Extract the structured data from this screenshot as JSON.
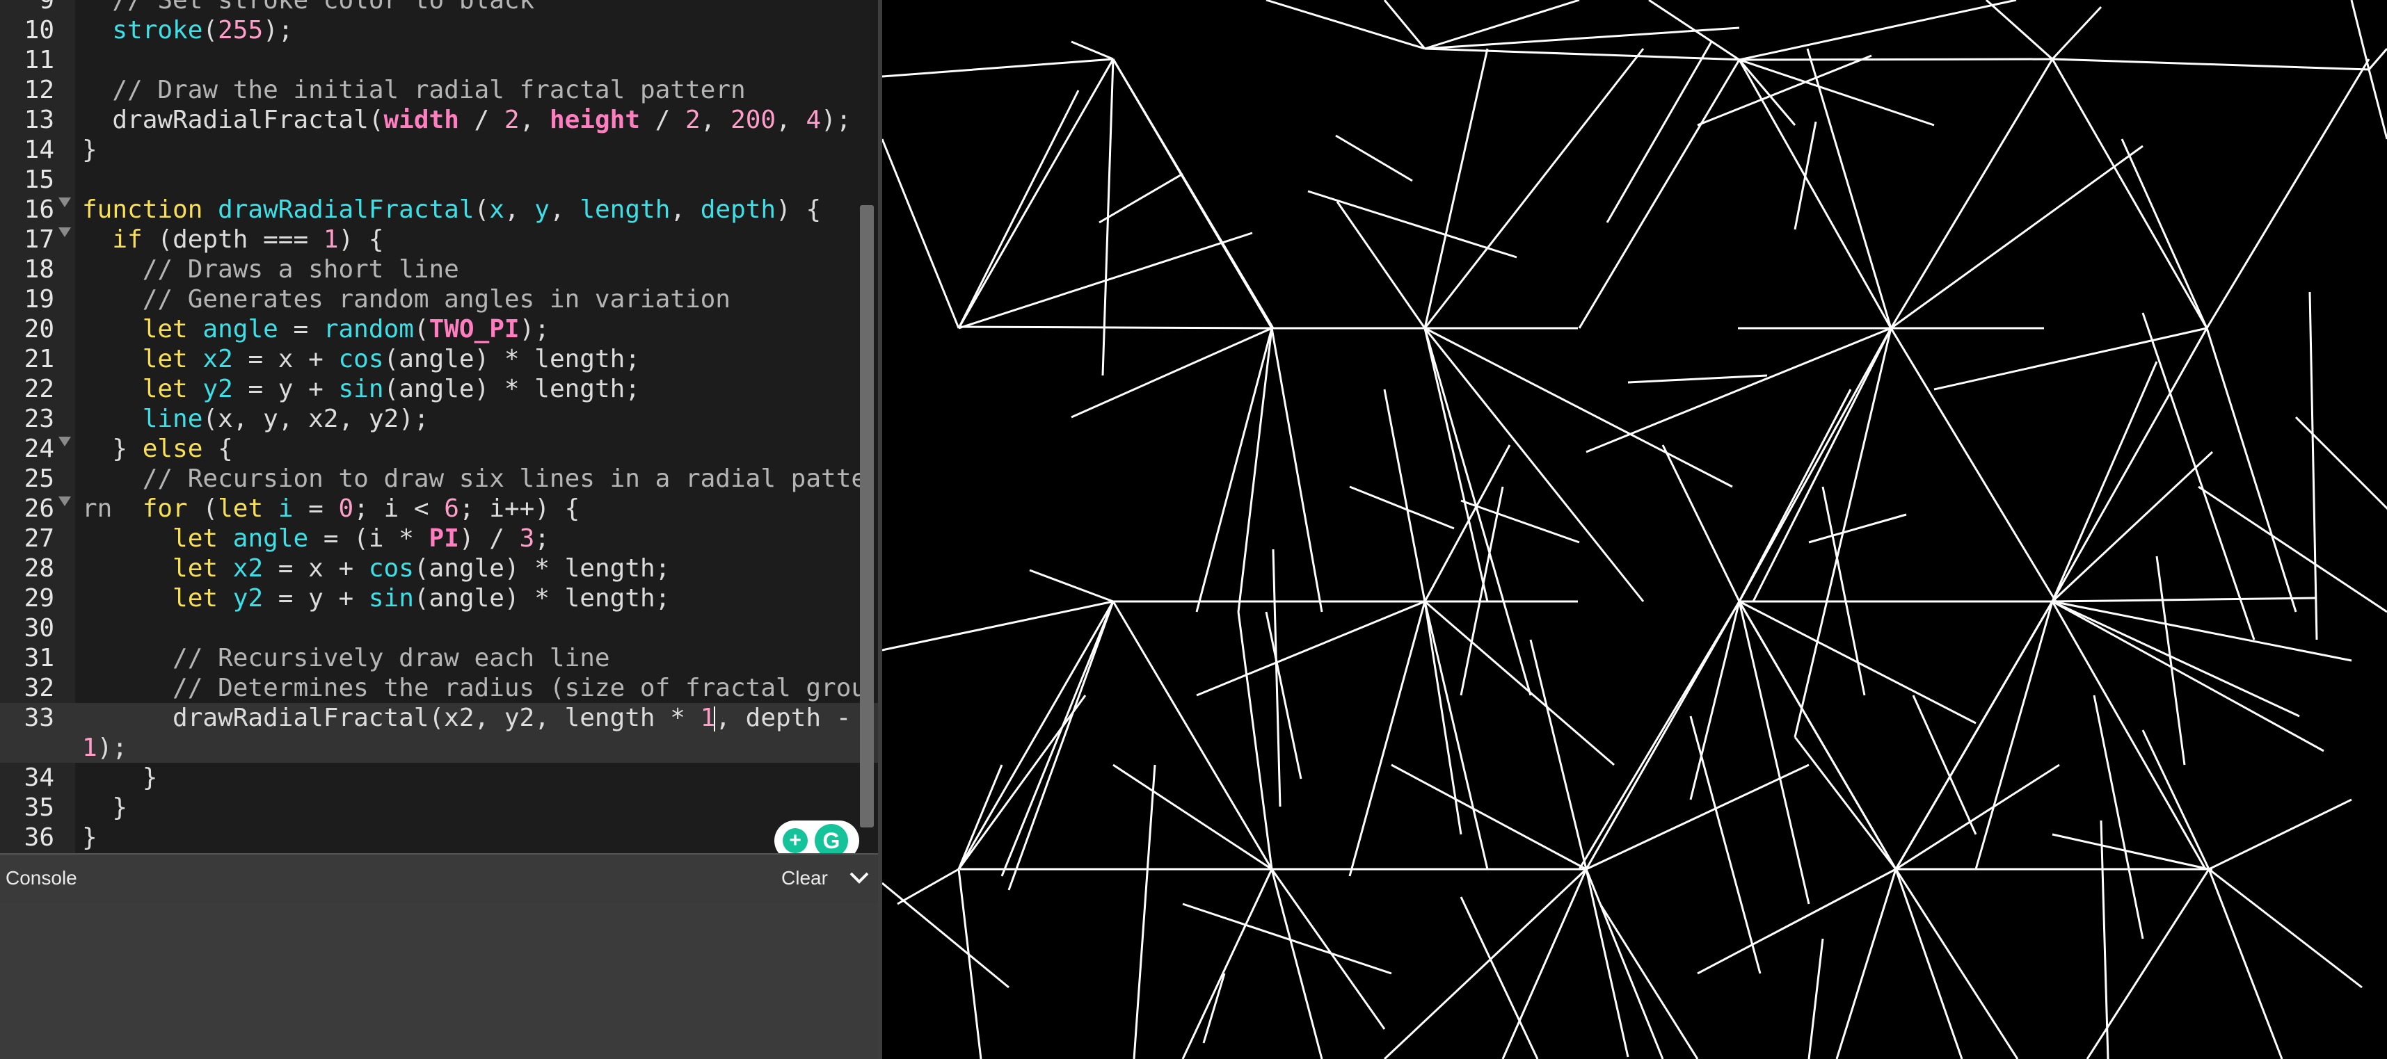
{
  "editor": {
    "lines": [
      {
        "n": "9",
        "fold": false,
        "tokens": [
          {
            "t": "  "
          },
          {
            "t": "// Set stroke color to black",
            "c": "comment"
          }
        ]
      },
      {
        "n": "10",
        "fold": false,
        "tokens": [
          {
            "t": "  "
          },
          {
            "t": "stroke",
            "c": "fn"
          },
          {
            "t": "("
          },
          {
            "t": "255",
            "c": "num"
          },
          {
            "t": ");"
          }
        ]
      },
      {
        "n": "11",
        "fold": false,
        "tokens": []
      },
      {
        "n": "12",
        "fold": false,
        "tokens": [
          {
            "t": "  "
          },
          {
            "t": "// Draw the initial radial fractal pattern",
            "c": "comment"
          }
        ]
      },
      {
        "n": "13",
        "fold": false,
        "tokens": [
          {
            "t": "  drawRadialFractal("
          },
          {
            "t": "width",
            "c": "bk"
          },
          {
            "t": " / "
          },
          {
            "t": "2",
            "c": "num"
          },
          {
            "t": ", "
          },
          {
            "t": "height",
            "c": "bk"
          },
          {
            "t": " / "
          },
          {
            "t": "2",
            "c": "num"
          },
          {
            "t": ", "
          },
          {
            "t": "200",
            "c": "num"
          },
          {
            "t": ", "
          },
          {
            "t": "4",
            "c": "num"
          },
          {
            "t": ");"
          }
        ]
      },
      {
        "n": "14",
        "fold": false,
        "tokens": [
          {
            "t": "}"
          }
        ]
      },
      {
        "n": "15",
        "fold": false,
        "tokens": []
      },
      {
        "n": "16",
        "fold": true,
        "tokens": [
          {
            "t": "function",
            "c": "kw"
          },
          {
            "t": " "
          },
          {
            "t": "drawRadialFractal",
            "c": "fn"
          },
          {
            "t": "("
          },
          {
            "t": "x",
            "c": "fn"
          },
          {
            "t": ", "
          },
          {
            "t": "y",
            "c": "fn"
          },
          {
            "t": ", "
          },
          {
            "t": "length",
            "c": "fn"
          },
          {
            "t": ", "
          },
          {
            "t": "depth",
            "c": "fn"
          },
          {
            "t": ") {"
          }
        ]
      },
      {
        "n": "17",
        "fold": true,
        "tokens": [
          {
            "t": "  "
          },
          {
            "t": "if",
            "c": "kw"
          },
          {
            "t": " (depth === "
          },
          {
            "t": "1",
            "c": "num"
          },
          {
            "t": ") {"
          }
        ]
      },
      {
        "n": "18",
        "fold": false,
        "tokens": [
          {
            "t": "    "
          },
          {
            "t": "// Draws a short line",
            "c": "comment"
          }
        ]
      },
      {
        "n": "19",
        "fold": false,
        "tokens": [
          {
            "t": "    "
          },
          {
            "t": "// Generates random angles in variation",
            "c": "comment"
          }
        ]
      },
      {
        "n": "20",
        "fold": false,
        "tokens": [
          {
            "t": "    "
          },
          {
            "t": "let",
            "c": "kw"
          },
          {
            "t": " "
          },
          {
            "t": "angle",
            "c": "fn"
          },
          {
            "t": " = "
          },
          {
            "t": "random",
            "c": "fn"
          },
          {
            "t": "("
          },
          {
            "t": "TWO_PI",
            "c": "bk"
          },
          {
            "t": ");"
          }
        ]
      },
      {
        "n": "21",
        "fold": false,
        "tokens": [
          {
            "t": "    "
          },
          {
            "t": "let",
            "c": "kw"
          },
          {
            "t": " "
          },
          {
            "t": "x2",
            "c": "fn"
          },
          {
            "t": " = x + "
          },
          {
            "t": "cos",
            "c": "fn"
          },
          {
            "t": "(angle) * length;"
          }
        ]
      },
      {
        "n": "22",
        "fold": false,
        "tokens": [
          {
            "t": "    "
          },
          {
            "t": "let",
            "c": "kw"
          },
          {
            "t": " "
          },
          {
            "t": "y2",
            "c": "fn"
          },
          {
            "t": " = y + "
          },
          {
            "t": "sin",
            "c": "fn"
          },
          {
            "t": "(angle) * length;"
          }
        ]
      },
      {
        "n": "23",
        "fold": false,
        "tokens": [
          {
            "t": "    "
          },
          {
            "t": "line",
            "c": "fn"
          },
          {
            "t": "(x, y, x2, y2);"
          }
        ]
      },
      {
        "n": "24",
        "fold": true,
        "tokens": [
          {
            "t": "  } "
          },
          {
            "t": "else",
            "c": "kw"
          },
          {
            "t": " {"
          }
        ]
      },
      {
        "n": "25",
        "fold": false,
        "tokens": [
          {
            "t": "    "
          },
          {
            "t": "// Recursion to draw six lines in a radial pattern",
            "c": "comment"
          }
        ]
      },
      {
        "n": "26",
        "fold": true,
        "tokens": [
          {
            "t": "    "
          },
          {
            "t": "for",
            "c": "kw"
          },
          {
            "t": " ("
          },
          {
            "t": "let",
            "c": "kw"
          },
          {
            "t": " "
          },
          {
            "t": "i",
            "c": "fn"
          },
          {
            "t": " = "
          },
          {
            "t": "0",
            "c": "num"
          },
          {
            "t": "; i < "
          },
          {
            "t": "6",
            "c": "num"
          },
          {
            "t": "; i++) {"
          }
        ]
      },
      {
        "n": "27",
        "fold": false,
        "tokens": [
          {
            "t": "      "
          },
          {
            "t": "let",
            "c": "kw"
          },
          {
            "t": " "
          },
          {
            "t": "angle",
            "c": "fn"
          },
          {
            "t": " = (i * "
          },
          {
            "t": "PI",
            "c": "bk"
          },
          {
            "t": ") / "
          },
          {
            "t": "3",
            "c": "num"
          },
          {
            "t": ";"
          }
        ]
      },
      {
        "n": "28",
        "fold": false,
        "tokens": [
          {
            "t": "      "
          },
          {
            "t": "let",
            "c": "kw"
          },
          {
            "t": " "
          },
          {
            "t": "x2",
            "c": "fn"
          },
          {
            "t": " = x + "
          },
          {
            "t": "cos",
            "c": "fn"
          },
          {
            "t": "(angle) * length;"
          }
        ]
      },
      {
        "n": "29",
        "fold": false,
        "tokens": [
          {
            "t": "      "
          },
          {
            "t": "let",
            "c": "kw"
          },
          {
            "t": " "
          },
          {
            "t": "y2",
            "c": "fn"
          },
          {
            "t": " = y + "
          },
          {
            "t": "sin",
            "c": "fn"
          },
          {
            "t": "(angle) * length;"
          }
        ]
      },
      {
        "n": "30",
        "fold": false,
        "tokens": []
      },
      {
        "n": "31",
        "fold": false,
        "tokens": [
          {
            "t": "      "
          },
          {
            "t": "// Recursively draw each line",
            "c": "comment"
          }
        ]
      },
      {
        "n": "32",
        "fold": false,
        "tokens": [
          {
            "t": "      "
          },
          {
            "t": "// Determines the radius (size of fractal group)",
            "c": "comment"
          }
        ]
      },
      {
        "n": "33",
        "fold": false,
        "active": true,
        "wrapped": true,
        "tokens": [
          {
            "t": "      drawRadialFractal(x2, y2, length * "
          },
          {
            "t": "1",
            "c": "num"
          },
          {
            "cursor": true
          },
          {
            "t": ", depth - "
          },
          {
            "t": "1",
            "c": "num"
          },
          {
            "t": ");"
          }
        ]
      },
      {
        "n": "34",
        "fold": false,
        "tokens": [
          {
            "t": "    }"
          }
        ]
      },
      {
        "n": "35",
        "fold": false,
        "tokens": [
          {
            "t": "  }"
          }
        ]
      },
      {
        "n": "36",
        "fold": false,
        "tokens": [
          {
            "t": "}"
          }
        ]
      }
    ]
  },
  "console": {
    "title": "Console",
    "clear_label": "Clear"
  },
  "canvas": {
    "background": "#000000",
    "stroke": "#ffffff"
  },
  "colors": {
    "keyword": "#f8df56",
    "function": "#3ee0e8",
    "number": "#ff9ec9",
    "builtin": "#ff7ec0",
    "comment": "#b5b5b5"
  }
}
